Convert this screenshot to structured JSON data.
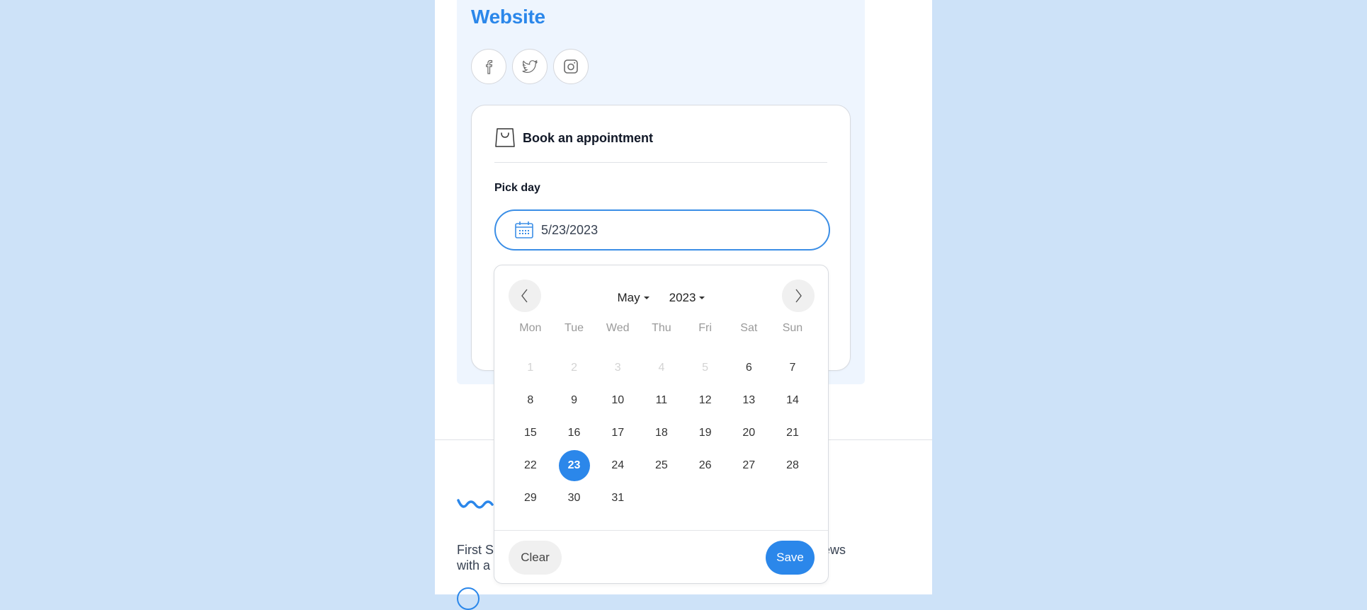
{
  "profile": {
    "website_title": "Website",
    "socials": [
      {
        "name": "facebook",
        "icon": "facebook-icon"
      },
      {
        "name": "twitter",
        "icon": "twitter-icon"
      },
      {
        "name": "instagram",
        "icon": "instagram-icon"
      }
    ]
  },
  "booking": {
    "title": "Book an appointment",
    "icon": "shopping-bag-icon",
    "pick_label": "Pick day",
    "date_value": "5/23/2023",
    "date_icon": "calendar-icon"
  },
  "calendar": {
    "month": "May",
    "year": "2023",
    "weekdays": [
      "Mon",
      "Tue",
      "Wed",
      "Thu",
      "Fri",
      "Sat",
      "Sun"
    ],
    "days": [
      {
        "label": "1",
        "state": "disabled"
      },
      {
        "label": "2",
        "state": "disabled"
      },
      {
        "label": "3",
        "state": "disabled"
      },
      {
        "label": "4",
        "state": "disabled"
      },
      {
        "label": "5",
        "state": "disabled"
      },
      {
        "label": "6",
        "state": "enabled"
      },
      {
        "label": "7",
        "state": "enabled"
      },
      {
        "label": "8",
        "state": "enabled"
      },
      {
        "label": "9",
        "state": "enabled"
      },
      {
        "label": "10",
        "state": "enabled"
      },
      {
        "label": "11",
        "state": "enabled"
      },
      {
        "label": "12",
        "state": "enabled"
      },
      {
        "label": "13",
        "state": "enabled"
      },
      {
        "label": "14",
        "state": "enabled"
      },
      {
        "label": "15",
        "state": "enabled"
      },
      {
        "label": "16",
        "state": "enabled"
      },
      {
        "label": "17",
        "state": "enabled"
      },
      {
        "label": "18",
        "state": "enabled"
      },
      {
        "label": "19",
        "state": "enabled"
      },
      {
        "label": "20",
        "state": "enabled"
      },
      {
        "label": "21",
        "state": "enabled"
      },
      {
        "label": "22",
        "state": "enabled"
      },
      {
        "label": "23",
        "state": "selected"
      },
      {
        "label": "24",
        "state": "enabled"
      },
      {
        "label": "25",
        "state": "enabled"
      },
      {
        "label": "26",
        "state": "enabled"
      },
      {
        "label": "27",
        "state": "enabled"
      },
      {
        "label": "28",
        "state": "enabled"
      },
      {
        "label": "29",
        "state": "enabled"
      },
      {
        "label": "30",
        "state": "enabled"
      },
      {
        "label": "31",
        "state": "enabled"
      }
    ],
    "clear_label": "Clear",
    "save_label": "Save"
  },
  "about": {
    "line1_start": "First S",
    "line1_end": "ews",
    "line2_start": "with a"
  },
  "colors": {
    "accent": "#2b87ea",
    "page_bg": "#cde2f8",
    "section_bg": "#eef5fe"
  }
}
